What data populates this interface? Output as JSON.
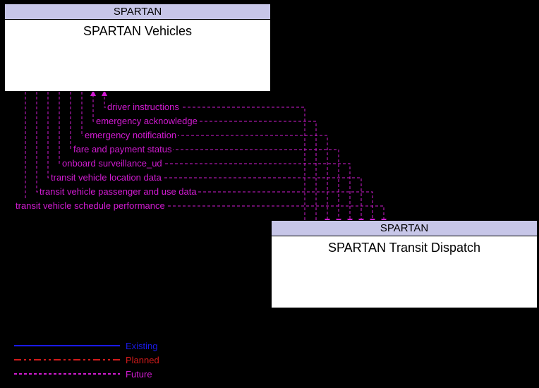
{
  "nodes": {
    "vehicles": {
      "header": "SPARTAN",
      "body": "SPARTAN Vehicles"
    },
    "dispatch": {
      "header": "SPARTAN",
      "body": "SPARTAN Transit Dispatch"
    }
  },
  "flows": [
    "driver instructions",
    "emergency acknowledge",
    "emergency notification",
    "fare and payment status",
    "onboard surveillance_ud",
    "transit vehicle location data",
    "transit vehicle passenger and use data",
    "transit vehicle schedule performance"
  ],
  "legend": {
    "existing": "Existing",
    "planned": "Planned",
    "future": "Future"
  },
  "colors": {
    "existing": "#1a1ae6",
    "planned": "#d21b1b",
    "future": "#d21bd2",
    "node_header": "#c7c6e8"
  }
}
